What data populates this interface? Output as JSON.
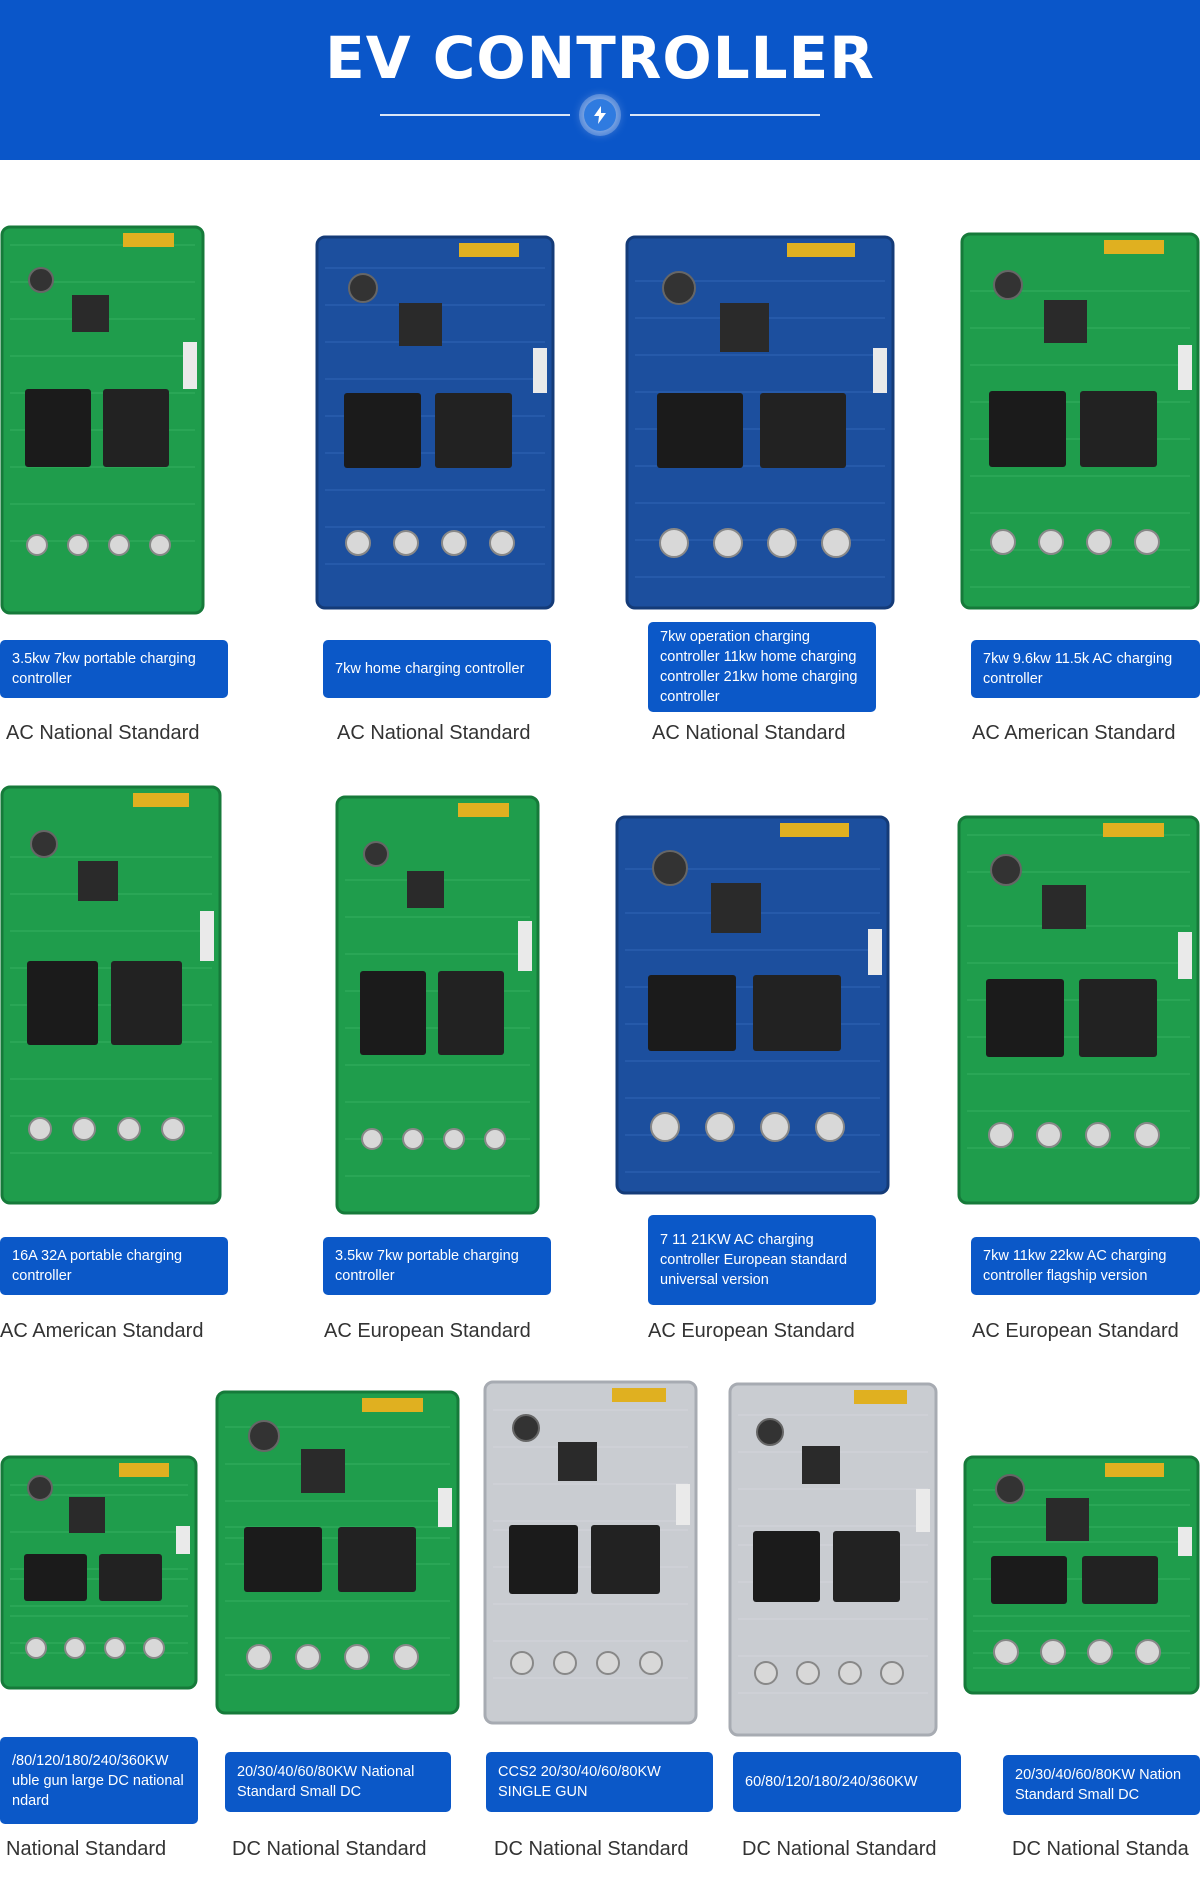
{
  "header": {
    "title": "EV CONTROLLER",
    "badge_icon": "lightning-bolt-icon",
    "color": "#0a56c9"
  },
  "products": [
    {
      "name": "3.5kw 7kw portable charging controller",
      "standard": "AC National Standard",
      "board": "green"
    },
    {
      "name": "7kw home charging controller",
      "standard": "AC National Standard",
      "board": "blue"
    },
    {
      "name": "7kw operation charging controller 11kw home charging controller 21kw home charging controller",
      "standard": "AC National Standard",
      "board": "blue"
    },
    {
      "name": "7kw 9.6kw 11.5k AC charging controller",
      "standard": "AC American Standard",
      "board": "green"
    },
    {
      "name": "16A 32A portable charging controller",
      "standard": "AC American Standard",
      "board": "green"
    },
    {
      "name": "3.5kw 7kw portable charging controller",
      "standard": "AC European Standard",
      "board": "green"
    },
    {
      "name": "7 11 21KW AC charging controller European standard universal version",
      "standard": "AC European Standard",
      "board": "blue"
    },
    {
      "name": "7kw 11kw 22kw AC charging controller flagship version",
      "standard": "AC European Standard",
      "board": "green"
    },
    {
      "name": "/80/120/180/240/360KW uble gun large DC national ndard",
      "standard": "National Standard",
      "board": "green"
    },
    {
      "name": "20/30/40/60/80KW National Standard Small DC",
      "standard": "DC National Standard",
      "board": "green"
    },
    {
      "name": "CCS2 20/30/40/60/80KW SINGLE GUN",
      "standard": "DC National Standard",
      "board": "metal"
    },
    {
      "name": "60/80/120/180/240/360KW",
      "standard": "DC National Standard",
      "board": "metal"
    },
    {
      "name": "20/30/40/60/80KW Nation Standard Small DC",
      "standard": "DC National Standa",
      "board": "green"
    }
  ],
  "colors": {
    "label_bg": "#0b58c8",
    "pcb_green": "#1f9d4c",
    "pcb_blue": "#1c4f9e",
    "metal": "#c9ccd1"
  }
}
